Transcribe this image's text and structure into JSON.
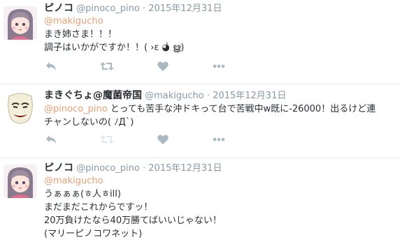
{
  "tweets": [
    {
      "name": "ピノコ",
      "handle": "@pinoco_pino",
      "date": "2015年12月31日",
      "mention": "@makigucho",
      "lines": [
        "まき姉さま！！！",
        "調子はいかがですか！！( ›ε ◕̀ ൠ)"
      ]
    },
    {
      "name": "まきぐちょ@魔菌帝国",
      "handle": "@makigucho",
      "date": "2015年12月31日",
      "mention": "@pinoco_pino",
      "text1": "とっても苦手な沖ドキって台で苦戦中w既に-26000！出るけど連",
      "lines": [
        "チャンしないの( ﾉД`)"
      ]
    },
    {
      "name": "ピノコ",
      "handle": "@pinoco_pino",
      "date": "2015年12月31日",
      "mention": "@makigucho",
      "lines": [
        "うぁぁぁ(ㅎ人ㅎill)",
        "まだまだこれからですッ！",
        "20万負けたなら40万勝てばいいじゃない！",
        "(マリーピノコワネット)"
      ]
    }
  ],
  "separator": "·",
  "icons": [
    "reply-icon",
    "retweet-icon",
    "like-icon",
    "more-icon"
  ],
  "colors": {
    "mention": "#e8a074",
    "meta": "#8899a6",
    "icon": "#aab8c2"
  }
}
